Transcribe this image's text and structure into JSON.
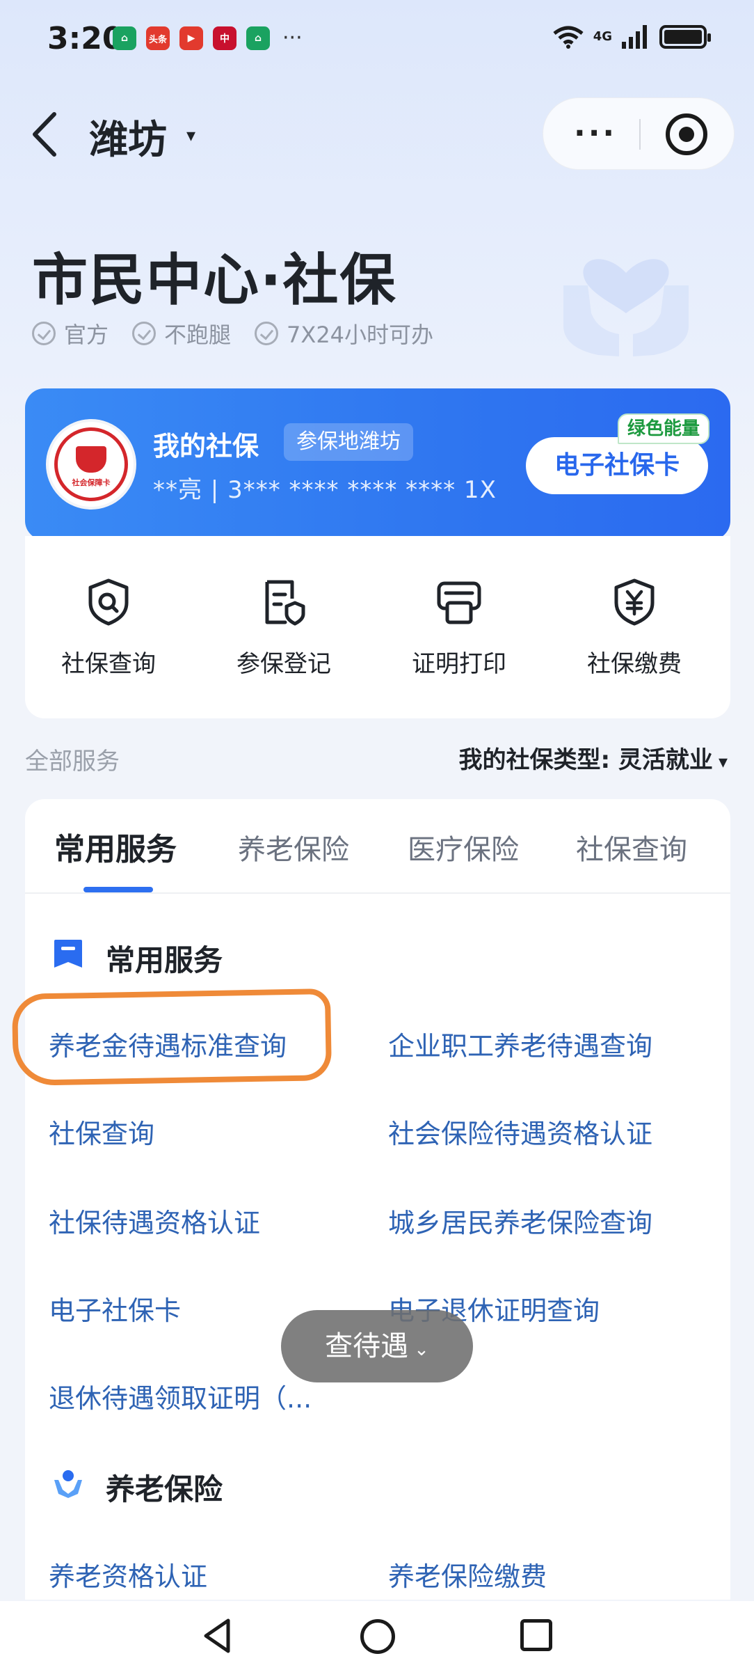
{
  "status_bar": {
    "time": "3:20",
    "network": "4G",
    "notifications": [
      {
        "name": "notif-app-green-1",
        "text": "⌂",
        "color": "#1aa260"
      },
      {
        "name": "notif-app-toutiao",
        "text": "头条",
        "color": "#e23a2e"
      },
      {
        "name": "notif-app-video",
        "text": "▶",
        "color": "#e23a2e"
      },
      {
        "name": "notif-app-bank",
        "text": "中",
        "color": "#c8102e"
      },
      {
        "name": "notif-app-green-2",
        "text": "⌂",
        "color": "#1aa260"
      }
    ],
    "more": "···"
  },
  "nav": {
    "city": "潍坊",
    "caret": "▾"
  },
  "header": {
    "title": "市民中心·社保",
    "badges": [
      "官方",
      "不跑腿",
      "7X24小时可办"
    ]
  },
  "card": {
    "title": "我的社保",
    "region_tag": "参保地潍坊",
    "masked_info": "**亮 | 3*** **** **** **** 1X",
    "ecard_button": "电子社保卡",
    "energy_badge": "绿色能量",
    "logo_text": "社会保障卡"
  },
  "quick_actions": [
    {
      "label": "社保查询",
      "icon": "shield-search-icon"
    },
    {
      "label": "参保登记",
      "icon": "document-shield-icon"
    },
    {
      "label": "证明打印",
      "icon": "printer-icon"
    },
    {
      "label": "社保缴费",
      "icon": "yen-shield-icon"
    }
  ],
  "services_bar": {
    "all_label": "全部服务",
    "type_label": "我的社保类型: 灵活就业",
    "caret": "▾"
  },
  "tabs": [
    "常用服务",
    "养老保险",
    "医疗保险",
    "社保查询"
  ],
  "sections": {
    "common": {
      "title": "常用服务",
      "items": [
        "养老金待遇标准查询",
        "企业职工养老待遇查询",
        "社保查询",
        "社会保险待遇资格认证",
        "社保待遇资格认证",
        "城乡居民养老保险查询",
        "电子社保卡",
        "电子退休证明查询",
        "退休待遇领取证明（..."
      ]
    },
    "pension": {
      "title": "养老保险",
      "items": [
        "养老资格认证",
        "养老保险缴费"
      ]
    }
  },
  "float_button": {
    "label": "查待遇",
    "chevron": "⌄"
  },
  "colors": {
    "brand_blue": "#2f76f0",
    "link_blue": "#2e63b4",
    "highlight_orange": "#ef8a38",
    "energy_green": "#1d9a3f"
  }
}
